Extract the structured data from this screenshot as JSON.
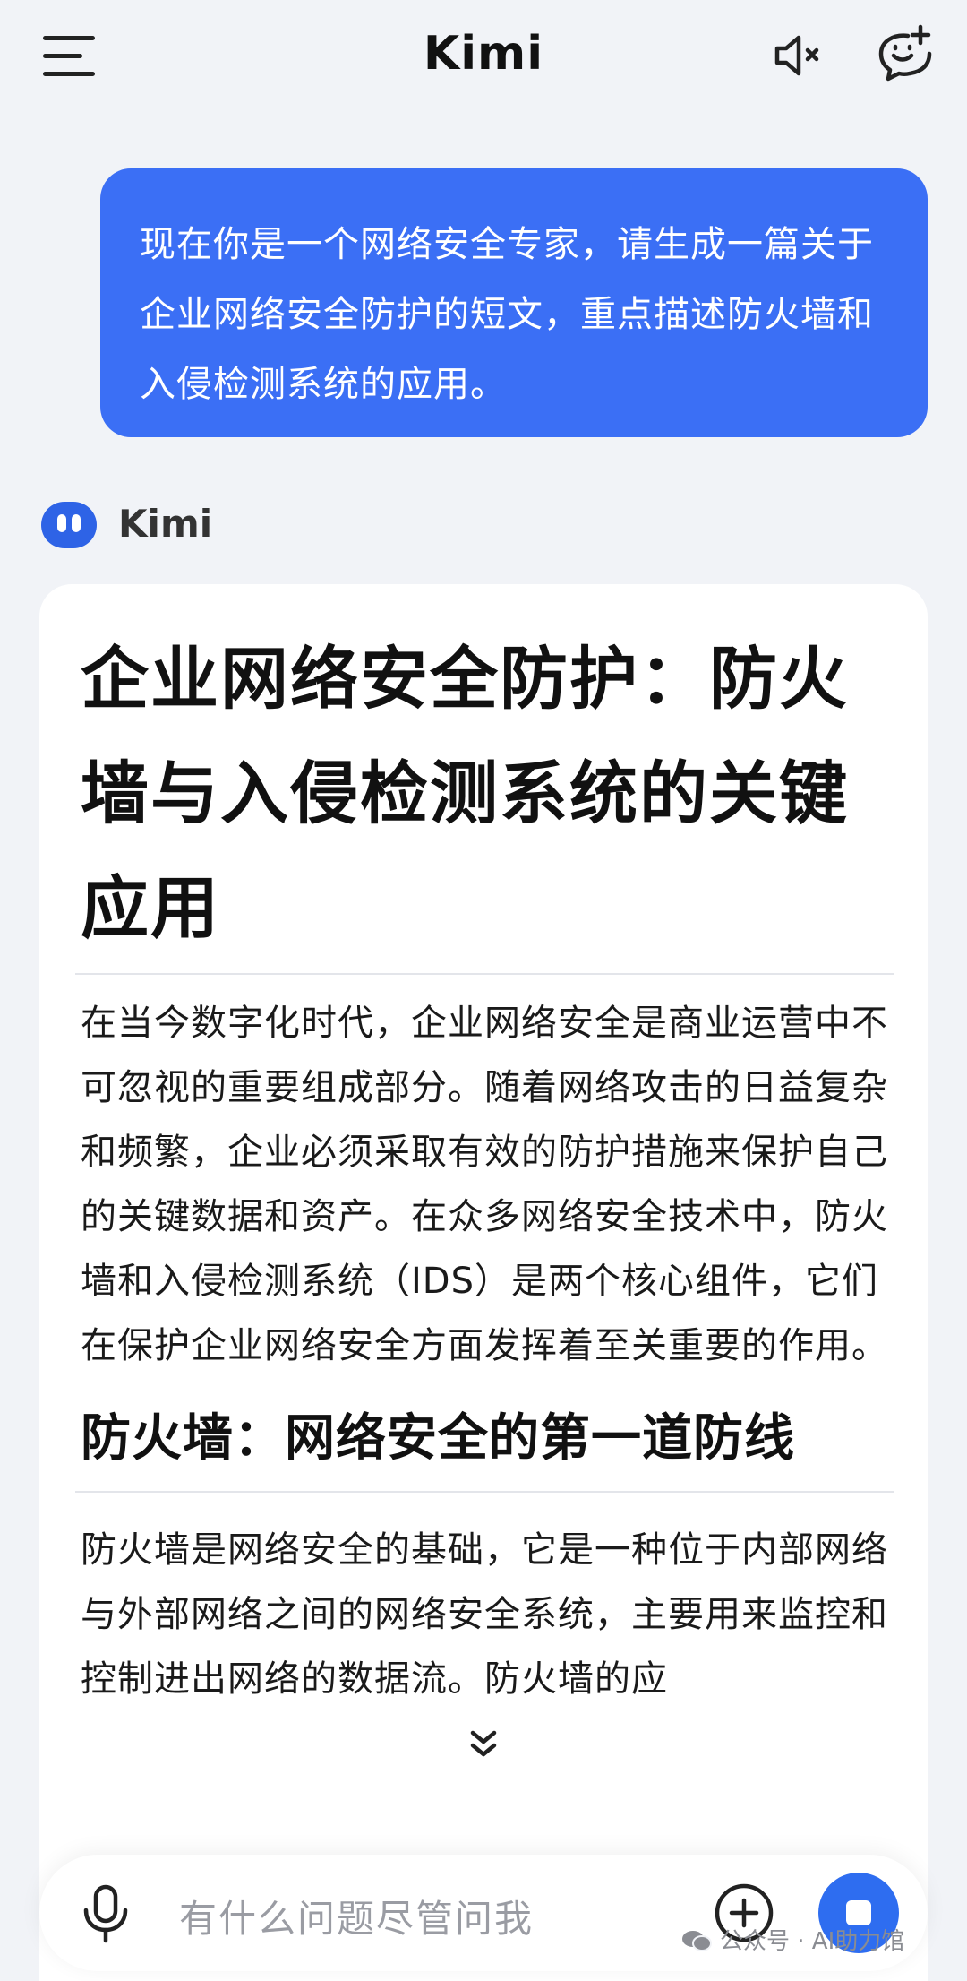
{
  "header": {
    "title": "Kimi",
    "menu_icon": "menu-icon",
    "mute_icon": "speaker-mute-icon",
    "new_chat_icon": "new-chat-icon"
  },
  "conversation": {
    "user_message": "现在你是一个网络安全专家，请生成一篇关于企业网络安全防护的短文，重点描述防火墙和入侵检测系统的应用。",
    "assistant": {
      "name": "Kimi",
      "title": "企业网络安全防护：防火墙与入侵检测系统的关键应用",
      "paragraph1": "在当今数字化时代，企业网络安全是商业运营中不可忽视的重要组成部分。随着网络攻击的日益复杂和频繁，企业必须采取有效的防护措施来保护自己的关键数据和资产。在众多网络安全技术中，防火墙和入侵检测系统（IDS）是两个核心组件，它们在保护企业网络安全方面发挥着至关重要的作用。",
      "section_heading": "防火墙：网络安全的第一道防线",
      "paragraph2": "防火墙是网络安全的基础，它是一种位于内部网络与外部网络之间的网络安全系统，主要用来监控和控制进出网络的数据流。防火墙的应"
    }
  },
  "input": {
    "placeholder": "有什么问题尽管问我"
  },
  "watermark": "公众号 · AI助力馆",
  "colors": {
    "accent": "#3b6ff5",
    "background": "#f1f3f7",
    "card": "#ffffff"
  }
}
